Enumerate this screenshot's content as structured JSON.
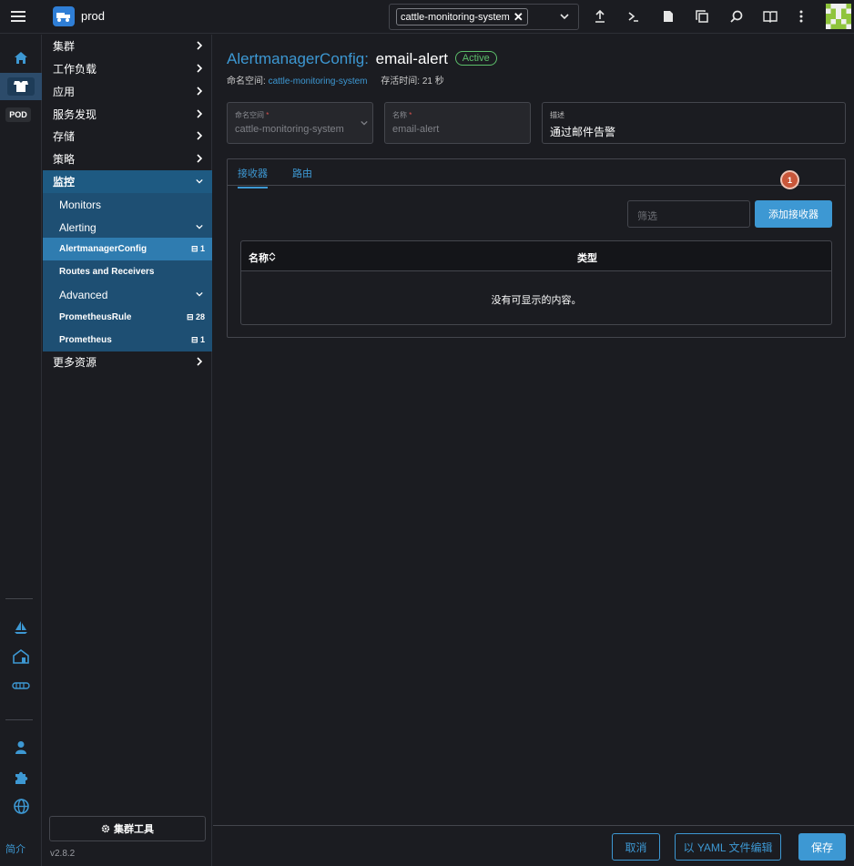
{
  "header": {
    "cluster_name": "prod",
    "namespace_chip": "cattle-monitoring-system",
    "chip_remove": "✕",
    "icons": [
      "upload-icon",
      "terminal-icon",
      "file-icon",
      "copy-icon",
      "search-icon",
      "book-icon",
      "more-vert-icon"
    ]
  },
  "rail": {
    "pod_label": "POD",
    "intro_label": "简介"
  },
  "sidenav": {
    "cluster": "集群",
    "workload": "工作负载",
    "apps": "应用",
    "service_discovery": "服务发现",
    "storage": "存储",
    "policy": "策略",
    "monitoring": "监控",
    "monitors": "Monitors",
    "alerting": "Alerting",
    "alertmanager_config": "AlertmanagerConfig",
    "alertmanager_config_count": "1",
    "routes_receivers": "Routes and Receivers",
    "advanced": "Advanced",
    "prometheus_rule": "PrometheusRule",
    "prometheus_rule_count": "28",
    "prometheus": "Prometheus",
    "prometheus_count": "1",
    "more_resources": "更多资源",
    "cluster_tools": "集群工具",
    "version": "v2.8.2"
  },
  "page": {
    "type_label": "AlertmanagerConfig:",
    "name": "email-alert",
    "status": "Active",
    "namespace_prefix": "命名空间:",
    "namespace": "cattle-monitoring-system",
    "age": "存活时间: 21 秒"
  },
  "form": {
    "namespace_label": "命名空间",
    "namespace_value": "cattle-monitoring-system",
    "name_label": "名称",
    "name_value": "email-alert",
    "required_mark": "*",
    "description_label": "描述",
    "description_value": "通过邮件告警"
  },
  "tabs": {
    "receivers": "接收器",
    "routes": "路由"
  },
  "receivers": {
    "filter_placeholder": "筛选",
    "add_button": "添加接收器",
    "step_badge": "1",
    "col_name": "名称",
    "col_type": "类型",
    "empty_text": "没有可显示的内容。"
  },
  "footer": {
    "cancel": "取消",
    "edit_yaml": "以 YAML 文件编辑",
    "save": "保存"
  },
  "colors": {
    "accent": "#3d98d3",
    "active_status": "#5dbf6b",
    "step_badge": "#c9573a"
  }
}
